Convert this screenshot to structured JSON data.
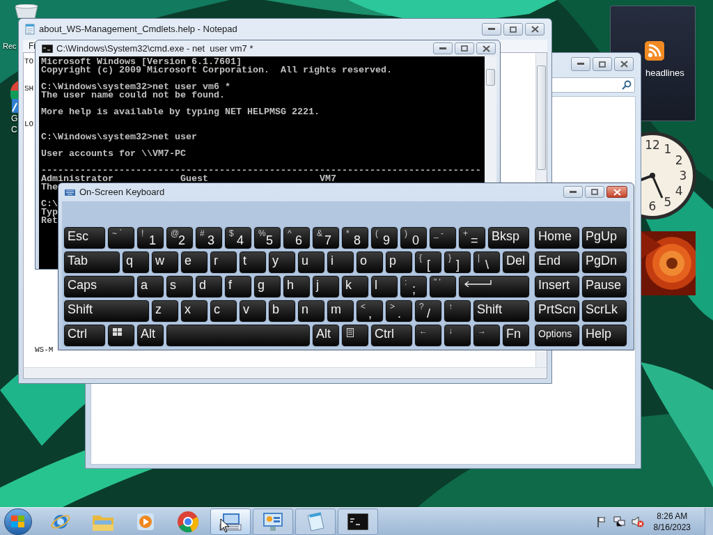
{
  "desktop_icons": [
    {
      "kind": "recycle-bin",
      "lines": [
        "Rec"
      ]
    },
    {
      "kind": "browser",
      "lines": [
        "G",
        "C"
      ]
    }
  ],
  "gadgets": {
    "feed": {
      "label": "headlines"
    },
    "clock": {
      "numerals": [
        "12",
        "1",
        "2",
        "3",
        "4",
        "5",
        "6"
      ]
    }
  },
  "notepad": {
    "title": "about_WS-Management_Cmdlets.help - Notepad",
    "menu": [
      "Fi"
    ],
    "lines": [
      "TO",
      "SH",
      "LO",
      "WS-M"
    ]
  },
  "cmd": {
    "title": "C:\\Windows\\System32\\cmd.exe - net  user vm7 *",
    "blocks": [
      [
        "Microsoft Windows [Version 6.1.7601]",
        "Copyright (c) 2009 Microsoft Corporation.  All rights reserved."
      ],
      [
        "C:\\Windows\\system32>net user vm6 *",
        "The user name could not be found."
      ],
      [
        "More help is available by typing NET HELPMSG 2221."
      ],
      [
        "C:\\Windows\\system32>net user"
      ],
      [
        "User accounts for \\\\VM7-PC"
      ],
      [
        "-------------------------------------------------------------------------------",
        "Administrator            Guest                    VM7",
        "The"
      ],
      [
        "C:\\",
        "Typ",
        "Ret"
      ]
    ]
  },
  "keyboard": {
    "title": "On-Screen Keyboard",
    "rows": [
      {
        "keys": [
          {
            "kind": "mod",
            "label": "Esc"
          },
          {
            "kind": "letter",
            "top": "~ `"
          },
          {
            "kind": "letter",
            "top": "!",
            "label": "1"
          },
          {
            "kind": "letter",
            "top": "@",
            "label": "2"
          },
          {
            "kind": "letter",
            "top": "#",
            "label": "3"
          },
          {
            "kind": "letter",
            "top": "$",
            "label": "4"
          },
          {
            "kind": "letter",
            "top": "%",
            "label": "5"
          },
          {
            "kind": "letter",
            "top": "^",
            "label": "6"
          },
          {
            "kind": "letter",
            "top": "&",
            "label": "7"
          },
          {
            "kind": "letter",
            "top": "*",
            "label": "8"
          },
          {
            "kind": "letter",
            "top": "(",
            "label": "9"
          },
          {
            "kind": "letter",
            "top": ")",
            "label": "0"
          },
          {
            "kind": "letter",
            "top": "_ -"
          },
          {
            "kind": "letter",
            "top": "+",
            "label": "="
          },
          {
            "kind": "mod",
            "label": "Bksp"
          }
        ]
      },
      {
        "keys": [
          {
            "kind": "tab",
            "label": "Tab"
          },
          {
            "kind": "letter",
            "label": "q"
          },
          {
            "kind": "letter",
            "label": "w"
          },
          {
            "kind": "letter",
            "label": "e"
          },
          {
            "kind": "letter",
            "label": "r"
          },
          {
            "kind": "letter",
            "label": "t"
          },
          {
            "kind": "letter",
            "label": "y"
          },
          {
            "kind": "letter",
            "label": "u"
          },
          {
            "kind": "letter",
            "label": "i"
          },
          {
            "kind": "letter",
            "label": "o"
          },
          {
            "kind": "letter",
            "label": "p"
          },
          {
            "kind": "letter",
            "top": "{",
            "label": "["
          },
          {
            "kind": "letter",
            "top": "}",
            "label": "]"
          },
          {
            "kind": "letter",
            "top": "|",
            "label": "\\"
          },
          {
            "kind": "letter",
            "label": "Del"
          }
        ]
      },
      {
        "keys": [
          {
            "kind": "caps",
            "label": "Caps"
          },
          {
            "kind": "letter",
            "label": "a"
          },
          {
            "kind": "letter",
            "label": "s"
          },
          {
            "kind": "letter",
            "label": "d"
          },
          {
            "kind": "letter",
            "label": "f"
          },
          {
            "kind": "letter",
            "label": "g"
          },
          {
            "kind": "letter",
            "label": "h"
          },
          {
            "kind": "letter",
            "label": "j"
          },
          {
            "kind": "letter",
            "label": "k"
          },
          {
            "kind": "letter",
            "label": "l"
          },
          {
            "kind": "letter",
            "top": ":",
            "label": ";"
          },
          {
            "kind": "letter",
            "top": "\" '"
          },
          {
            "kind": "enter"
          }
        ]
      },
      {
        "keys": [
          {
            "kind": "shift",
            "label": "Shift"
          },
          {
            "kind": "letter",
            "label": "z"
          },
          {
            "kind": "letter",
            "label": "x"
          },
          {
            "kind": "letter",
            "label": "c"
          },
          {
            "kind": "letter",
            "label": "v"
          },
          {
            "kind": "letter",
            "label": "b"
          },
          {
            "kind": "letter",
            "label": "n"
          },
          {
            "kind": "letter",
            "label": "m"
          },
          {
            "kind": "letter",
            "top": "<",
            "label": ","
          },
          {
            "kind": "letter",
            "top": ">",
            "label": "."
          },
          {
            "kind": "letter",
            "top": "?",
            "label": "/"
          },
          {
            "kind": "letter",
            "top": "↑"
          },
          {
            "kind": "rshift",
            "label": "Shift"
          }
        ]
      },
      {
        "keys": [
          {
            "kind": "mod",
            "label": "Ctrl"
          },
          {
            "kind": "windows"
          },
          {
            "kind": "letter",
            "label": "Alt"
          },
          {
            "kind": "space"
          },
          {
            "kind": "letter",
            "label": "Alt"
          },
          {
            "kind": "menu"
          },
          {
            "kind": "mod",
            "label": "Ctrl"
          },
          {
            "kind": "letter",
            "top": "←"
          },
          {
            "kind": "letter",
            "top": "↓"
          },
          {
            "kind": "letter",
            "top": "→"
          },
          {
            "kind": "letter",
            "label": "Fn"
          }
        ]
      }
    ],
    "side_rows": [
      [
        {
          "kind": "nav",
          "label": "Home"
        },
        {
          "kind": "nav",
          "label": "PgUp"
        }
      ],
      [
        {
          "kind": "nav",
          "label": "End"
        },
        {
          "kind": "nav",
          "label": "PgDn"
        }
      ],
      [
        {
          "kind": "nav",
          "label": "Insert"
        },
        {
          "kind": "nav",
          "label": "Pause"
        }
      ],
      [
        {
          "kind": "nav",
          "label": "PrtScn"
        },
        {
          "kind": "nav",
          "label": "ScrLk"
        }
      ],
      [
        {
          "kind": "option",
          "label": "Options"
        },
        {
          "kind": "nav",
          "label": "Help"
        }
      ]
    ]
  },
  "taskbar": {
    "apps": [
      {
        "kind": "ie",
        "running": false,
        "selected": false
      },
      {
        "kind": "explorer",
        "running": false,
        "selected": false
      },
      {
        "kind": "media",
        "running": false,
        "selected": false
      },
      {
        "kind": "chrome",
        "running": false,
        "selected": false
      },
      {
        "kind": "keyboard",
        "running": true,
        "selected": true
      },
      {
        "kind": "panel",
        "running": true,
        "selected": false
      },
      {
        "kind": "notepad",
        "running": true,
        "selected": false
      },
      {
        "kind": "cmd",
        "running": true,
        "selected": false
      }
    ],
    "clock": {
      "time": "8:26 AM",
      "date": "8/16/2023"
    }
  }
}
